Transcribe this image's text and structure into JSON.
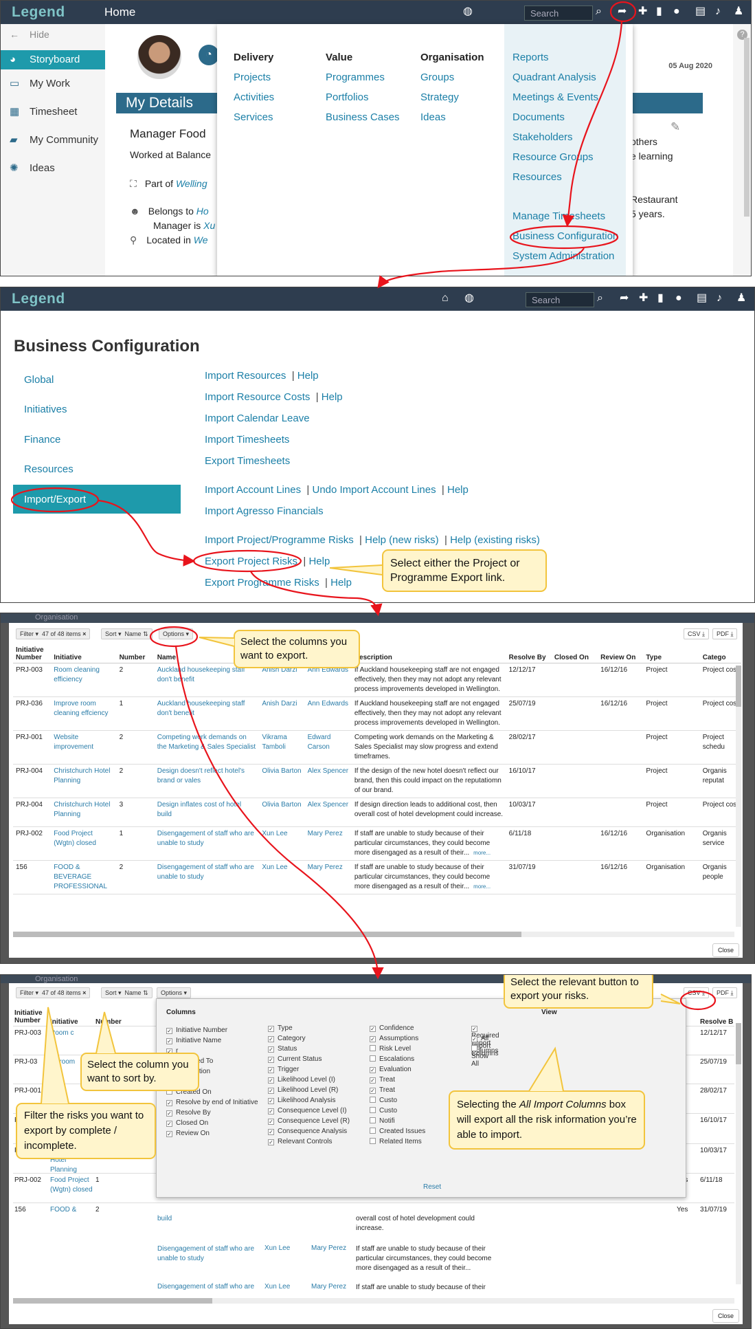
{
  "panel1": {
    "logo": "Legend",
    "page_title": "Home",
    "search_placeholder": "Search",
    "sidebar": {
      "hide": "Hide",
      "items": [
        {
          "label": "Storyboard",
          "icon": "dashboard-icon"
        },
        {
          "label": "My Work",
          "icon": "inbox-icon"
        },
        {
          "label": "Timesheet",
          "icon": "calendar-icon"
        },
        {
          "label": "My Community",
          "icon": "chat-icon"
        },
        {
          "label": "Ideas",
          "icon": "lightbulb-icon"
        }
      ]
    },
    "date": "05 Aug 2020",
    "my_details": "My Details",
    "profile": {
      "role": "Manager Food",
      "worked": "Worked at Balance",
      "part_of": "Part of",
      "part_of_link": "Welling",
      "belongs_to": "Belongs to",
      "belongs_link": "Ho",
      "manager_is": "Manager is",
      "manager_link": "Xu",
      "located_in": "Located in",
      "located_link": "We",
      "right_text_1": "/",
      "right_text_2": "others",
      "right_text_3": "e learning",
      "right_text_4": "Restaurant",
      "right_text_5": "5 years."
    },
    "mega_menu": {
      "columns": [
        {
          "heading": "Delivery",
          "links": [
            "Projects",
            "Activities",
            "Services"
          ]
        },
        {
          "heading": "Value",
          "links": [
            "Programmes",
            "Portfolios",
            "Business Cases"
          ]
        },
        {
          "heading": "Organisation",
          "links": [
            "Groups",
            "Strategy",
            "Ideas"
          ]
        }
      ],
      "right_links": [
        "Reports",
        "Quadrant Analysis",
        "Meetings & Events",
        "Documents",
        "Stakeholders",
        "Resource Groups",
        "Resources"
      ],
      "right_links_2": [
        "Manage Timesheets",
        "Business Configuration",
        "System Administration"
      ]
    }
  },
  "panel2": {
    "logo": "Legend",
    "search_placeholder": "Search",
    "title": "Business Configuration",
    "side": [
      "Global",
      "Initiatives",
      "Finance",
      "Resources",
      "Import/Export"
    ],
    "rows": [
      {
        "links": [
          "Import Resources",
          "Help"
        ]
      },
      {
        "links": [
          "Import Resource Costs",
          "Help"
        ]
      },
      {
        "links": [
          "Import Calendar Leave"
        ]
      },
      {
        "links": [
          "Import Timesheets"
        ]
      },
      {
        "links": [
          "Export Timesheets"
        ]
      },
      {
        "links": [
          "Import Account Lines",
          "Undo Import Account Lines",
          "Help"
        ]
      },
      {
        "links": [
          "Import Agresso Financials"
        ]
      },
      {
        "links": [
          "Import Project/Programme Risks",
          "Help (new risks)",
          "Help (existing risks)"
        ]
      },
      {
        "links": [
          "Export Project Risks",
          "Help"
        ]
      },
      {
        "links": [
          "Export Programme Risks",
          "Help"
        ]
      }
    ],
    "callout": "Select either the Project or Programme Export link."
  },
  "grid": {
    "top_faded": "Organisation",
    "filter": "Filter",
    "count": "47 of 48 items",
    "sort": "Sort",
    "sort_field": "Name",
    "options": "Options",
    "csv": "CSV",
    "pdf": "PDF",
    "close": "Close",
    "more": "more...",
    "headers": [
      "Initiative Number",
      "Initiative",
      "Number",
      "Name",
      "",
      "",
      "Description",
      "Resolve By",
      "Closed On",
      "Review On",
      "Type",
      "Catego"
    ],
    "rows": [
      [
        "PRJ-003",
        "Room cleaning efficiency",
        "2",
        "Auckland housekeeping staff don't benefit",
        "Anish Darzi",
        "Ann Edwards",
        "If Auckland housekeeping staff are not engaged effectively, then they may not adopt any relevant process improvements developed in Wellington.",
        "12/12/17",
        "",
        "16/12/16",
        "Project",
        "Project cost"
      ],
      [
        "PRJ-036",
        "Improve room cleaning effciency",
        "1",
        "Auckland housekeeping staff don't benefit",
        "Anish Darzi",
        "Ann Edwards",
        "If Auckland housekeeping staff are not engaged effectively, then they may not adopt any relevant process improvements developed in Wellington.",
        "25/07/19",
        "",
        "16/12/16",
        "Project",
        "Project cost"
      ],
      [
        "PRJ-001",
        "Website improvement",
        "2",
        "Competing work demands on the Marketing & Sales Specialist",
        "Vikrama Tamboli",
        "Edward Carson",
        "Competing work demands on the Marketing & Sales Specialist may slow progress and extend timeframes.",
        "28/02/17",
        "",
        "",
        "Project",
        "Project schedu"
      ],
      [
        "PRJ-004",
        "Christchurch Hotel Planning",
        "2",
        "Design doesn't reflect hotel's brand or vales",
        "Olivia Barton",
        "Alex Spencer",
        "If the design of the new hotel doesn't reflect our brand, then this could impact on the reputatiomn of our brand.",
        "16/10/17",
        "",
        "",
        "Project",
        "Organis reputat"
      ],
      [
        "PRJ-004",
        "Christchurch Hotel Planning",
        "3",
        "Design inflates cost of hotel build",
        "Olivia Barton",
        "Alex Spencer",
        "If design direction leads to additional cost, then overall cost of hotel development could increase.",
        "10/03/17",
        "",
        "",
        "Project",
        "Project cost"
      ],
      [
        "PRJ-002",
        "Food Project (Wgtn) closed",
        "1",
        "Disengagement of staff who are unable to study",
        "Xun Lee",
        "Mary Perez",
        "If staff are unable to study because of their particular circumstances, they could become more disengaged as a result of their...",
        "6/11/18",
        "",
        "16/12/16",
        "Organisation",
        "Organis service"
      ],
      [
        "156",
        "FOOD & BEVERAGE PROFESSIONAL",
        "2",
        "Disengagement of staff who are unable to study",
        "Xun Lee",
        "Mary Perez",
        "If staff are unable to study because of their particular circumstances, they could become more disengaged as a result of their...",
        "31/07/19",
        "",
        "16/12/16",
        "Organisation",
        "Organis people"
      ]
    ],
    "callout": "Select the columns you want to export."
  },
  "panel4": {
    "headers": [
      "Initiative Number",
      "Initiative",
      "Number",
      "ive",
      "Resolve B"
    ],
    "rows": [
      [
        "PRJ-003",
        "Room c",
        "",
        "",
        "12/12/17"
      ],
      [
        "PRJ-03",
        "ve room",
        "1",
        "",
        "25/07/19"
      ],
      [
        "PRJ-001",
        "",
        "",
        "",
        "28/02/17"
      ],
      [
        "PRJ-004",
        "Christchurch Hotel Planning",
        "2",
        "",
        "16/10/17"
      ],
      [
        "PRJ-004",
        "Christchurch Hotel Planning",
        "3",
        "",
        "10/03/17"
      ],
      [
        "PRJ-002",
        "Food Project (Wgtn) closed",
        "1",
        "Yes",
        "6/11/18"
      ],
      [
        "156",
        "FOOD &",
        "2",
        "Yes",
        "31/07/19"
      ]
    ],
    "visible_names": [
      "build",
      "Disengagement of staff who are unable to study",
      "Disengagement of staff who are"
    ],
    "visible_people": [
      "Xun Lee",
      "Mary Perez"
    ],
    "visible_desc": [
      "overall cost of hotel development could increase.",
      "If staff are unable to study because of their particular circumstances, they could become more disengaged as a result of their...",
      "If staff are unable to study because of their"
    ],
    "options": {
      "columns_title": "Columns",
      "view_title": "View",
      "col1": [
        {
          "label": "Initiative Number",
          "checked": true
        },
        {
          "label": "Initiative Name",
          "checked": true
        },
        {
          "label": "r",
          "checked": true
        },
        {
          "label": "Assigned To",
          "checked": true
        },
        {
          "label": "Description",
          "checked": true
        },
        {
          "label": "Notes",
          "checked": true
        },
        {
          "label": "Created On",
          "checked": false
        },
        {
          "label": "Resolve by end of Initiative",
          "checked": true
        },
        {
          "label": "Resolve By",
          "checked": true
        },
        {
          "label": "Closed On",
          "checked": true
        },
        {
          "label": "Review On",
          "checked": true
        }
      ],
      "col2": [
        {
          "label": "Type",
          "checked": true
        },
        {
          "label": "Category",
          "checked": true
        },
        {
          "label": "Status",
          "checked": true
        },
        {
          "label": "Current Status",
          "checked": true
        },
        {
          "label": "Trigger",
          "checked": true
        },
        {
          "label": "Likelihood Level (I)",
          "checked": true
        },
        {
          "label": "Likelihood Level (R)",
          "checked": true
        },
        {
          "label": "Likelihood Analysis",
          "checked": true
        },
        {
          "label": "Consequence Level (I)",
          "checked": true
        },
        {
          "label": "Consequence Level (R)",
          "checked": true
        },
        {
          "label": "Consequence Analysis",
          "checked": true
        },
        {
          "label": "Relevant Controls",
          "checked": true
        }
      ],
      "col3": [
        {
          "label": "Confidence",
          "checked": true
        },
        {
          "label": "Assumptions",
          "checked": true
        },
        {
          "label": "Risk Level",
          "checked": false
        },
        {
          "label": "Escalations",
          "checked": false
        },
        {
          "label": "Evaluation",
          "checked": true
        },
        {
          "label": "Treat",
          "checked": true
        },
        {
          "label": "Treat",
          "checked": true
        },
        {
          "label": "Custo",
          "checked": false
        },
        {
          "label": "Custo",
          "checked": false
        },
        {
          "label": "Notifi",
          "checked": false
        },
        {
          "label": "Created Issues",
          "checked": false
        },
        {
          "label": "Related Items",
          "checked": false
        }
      ],
      "view": [
        {
          "label": "Required Import Columns",
          "checked": true
        },
        {
          "label": "All Import Columns",
          "checked": true
        },
        {
          "label": "Show All",
          "checked": false
        }
      ],
      "reset": "Reset"
    },
    "callout_sort": "Select the column you want to sort by.",
    "callout_filter": "Filter the risks you want to export by complete / incomplete.",
    "callout_button": "Select the relevant button to export your risks.",
    "callout_all_pre": "Selecting the ",
    "callout_all_em": "All Import Columns",
    "callout_all_post": " box will export all the risk information you’re able to import."
  },
  "colors": {
    "header": "#2e3d4f",
    "accent": "#1e9aab",
    "link": "#1b7fa7",
    "callout_bg": "#fff5cc",
    "callout_border": "#f2c43c",
    "arrow": "#e8141c"
  }
}
